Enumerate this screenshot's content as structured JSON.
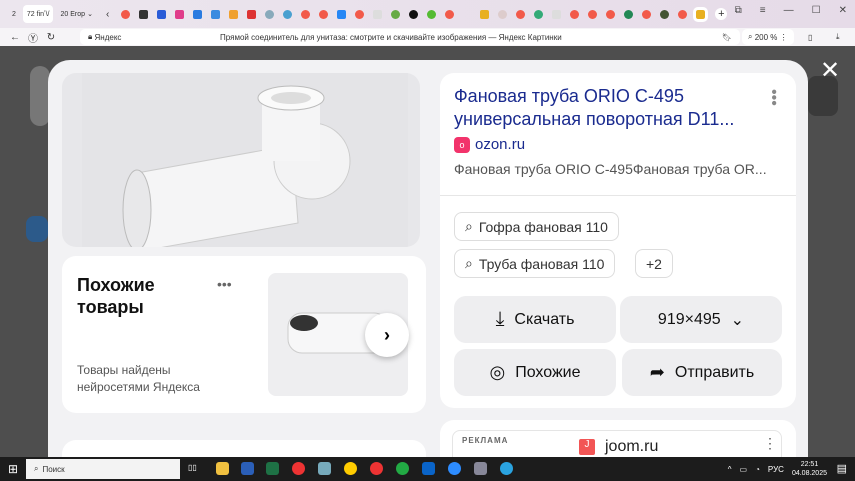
{
  "browser": {
    "tabs": [
      {
        "label": "2"
      },
      {
        "label": "72 ﬁnʼ\\/"
      },
      {
        "label": "20 Егор"
      }
    ],
    "address_site": "Яндекс",
    "page_title": "Прямой соединитель для унитаза: смотрите и скачивайте изображения — Яндекс Картинки",
    "zoom": "200 %"
  },
  "modal": {
    "similar": {
      "title": "Похожие товары",
      "subtitle": "Товары найдены нейросетями Яндекса"
    },
    "title": "Фановая труба ORIO C-495 универсальная поворотная D11...",
    "source": "ozon.ru",
    "description": "Фановая труба ORIO C-495Фановая труба OR...",
    "tags": [
      "Гофра фановая 110",
      "Труба фановая 110"
    ],
    "more_tags": "+2",
    "download_label": "Скачать",
    "size_label": "919×495",
    "similar_label": "Похожие",
    "share_label": "Отправить",
    "ad": {
      "label": "РЕКЛАМА",
      "site": "joom.ru"
    }
  },
  "taskbar": {
    "search_placeholder": "Поиск",
    "lang": "РУС",
    "time": "22:51",
    "date": "04.08.2025"
  }
}
